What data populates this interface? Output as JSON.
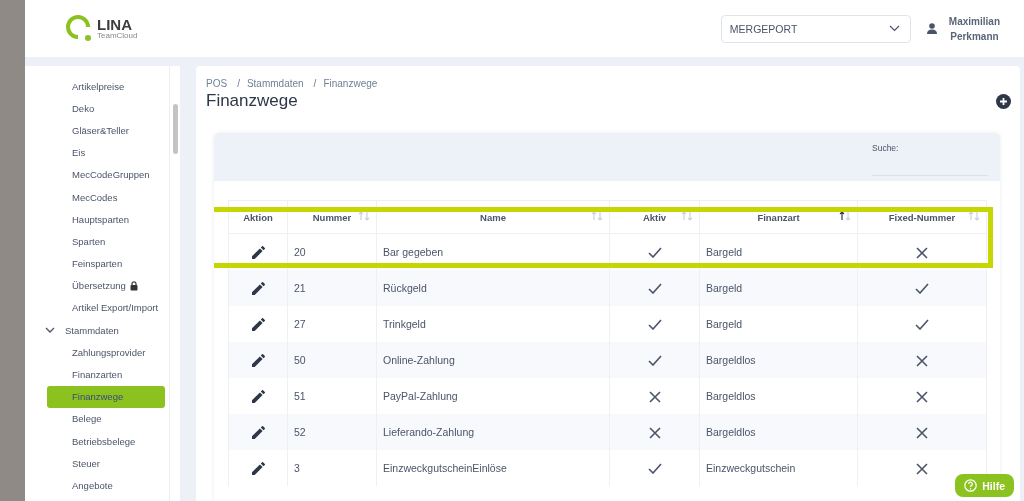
{
  "header": {
    "logo": {
      "name": "LINA",
      "tagline": "TeamCloud"
    },
    "company_select": {
      "value": "MERGEPORT"
    },
    "user": {
      "first_name": "Maximilian",
      "last_name": "Perkmann"
    }
  },
  "sidebar": {
    "items": [
      {
        "kind": "item",
        "label": "Artikelpreise",
        "selected": false
      },
      {
        "kind": "item",
        "label": "Deko",
        "selected": false
      },
      {
        "kind": "item",
        "label": "Gläser&Teller",
        "selected": false
      },
      {
        "kind": "item",
        "label": "Eis",
        "selected": false
      },
      {
        "kind": "item",
        "label": "MecCodeGruppen",
        "selected": false
      },
      {
        "kind": "item",
        "label": "MecCodes",
        "selected": false
      },
      {
        "kind": "item",
        "label": "Hauptsparten",
        "selected": false
      },
      {
        "kind": "item",
        "label": "Sparten",
        "selected": false
      },
      {
        "kind": "item",
        "label": "Feinsparten",
        "selected": false
      },
      {
        "kind": "locked",
        "label": "Übersetzung",
        "selected": false
      },
      {
        "kind": "item",
        "label": "Artikel Export/Import",
        "selected": false
      },
      {
        "kind": "group",
        "label": "Stammdaten",
        "expanded": true,
        "children": [
          {
            "kind": "item",
            "label": "Zahlungsprovider",
            "selected": false
          },
          {
            "kind": "item",
            "label": "Finanzarten",
            "selected": false
          },
          {
            "kind": "item",
            "label": "Finanzwege",
            "selected": true
          },
          {
            "kind": "item",
            "label": "Belege",
            "selected": false
          },
          {
            "kind": "item",
            "label": "Betriebsbelege",
            "selected": false
          },
          {
            "kind": "item",
            "label": "Steuer",
            "selected": false
          },
          {
            "kind": "item",
            "label": "Angebote",
            "selected": false
          }
        ]
      }
    ]
  },
  "breadcrumb": {
    "separator": "/",
    "items": [
      "POS",
      "Stammdaten",
      "Finanzwege"
    ]
  },
  "page_title": "Finanzwege",
  "search": {
    "label": "Suche:"
  },
  "table": {
    "highlight_frame": true,
    "columns": [
      {
        "label": "Aktion",
        "sortable": false
      },
      {
        "label": "Nummer",
        "sortable": true,
        "sorted_ascending": false
      },
      {
        "label": "Name",
        "sortable": true,
        "sorted_ascending": false
      },
      {
        "label": "Aktiv",
        "sortable": true,
        "sorted_ascending": false
      },
      {
        "label": "Finanzart",
        "sortable": true,
        "sorted_ascending": true
      },
      {
        "label": "Fixed-Nummer",
        "sortable": true,
        "sorted_ascending": false
      }
    ],
    "rows": [
      {
        "nummer": "20",
        "name": "Bar gegeben",
        "aktiv": true,
        "finanzart": "Bargeld",
        "fixed_nummer": false
      },
      {
        "nummer": "21",
        "name": "Rückgeld",
        "aktiv": true,
        "finanzart": "Bargeld",
        "fixed_nummer": true
      },
      {
        "nummer": "27",
        "name": "Trinkgeld",
        "aktiv": true,
        "finanzart": "Bargeld",
        "fixed_nummer": true
      },
      {
        "nummer": "50",
        "name": "Online-Zahlung",
        "aktiv": true,
        "finanzart": "Bargeldlos",
        "fixed_nummer": false
      },
      {
        "nummer": "51",
        "name": "PayPal-Zahlung",
        "aktiv": false,
        "finanzart": "Bargeldlos",
        "fixed_nummer": false
      },
      {
        "nummer": "52",
        "name": "Lieferando-Zahlung",
        "aktiv": false,
        "finanzart": "Bargeldlos",
        "fixed_nummer": false
      },
      {
        "nummer": "3",
        "name": "EinzweckgutscheinEinlöse",
        "aktiv": true,
        "finanzart": "Einzweckgutschein",
        "fixed_nummer": false
      }
    ]
  },
  "help_button": {
    "label": "Hilfe"
  }
}
